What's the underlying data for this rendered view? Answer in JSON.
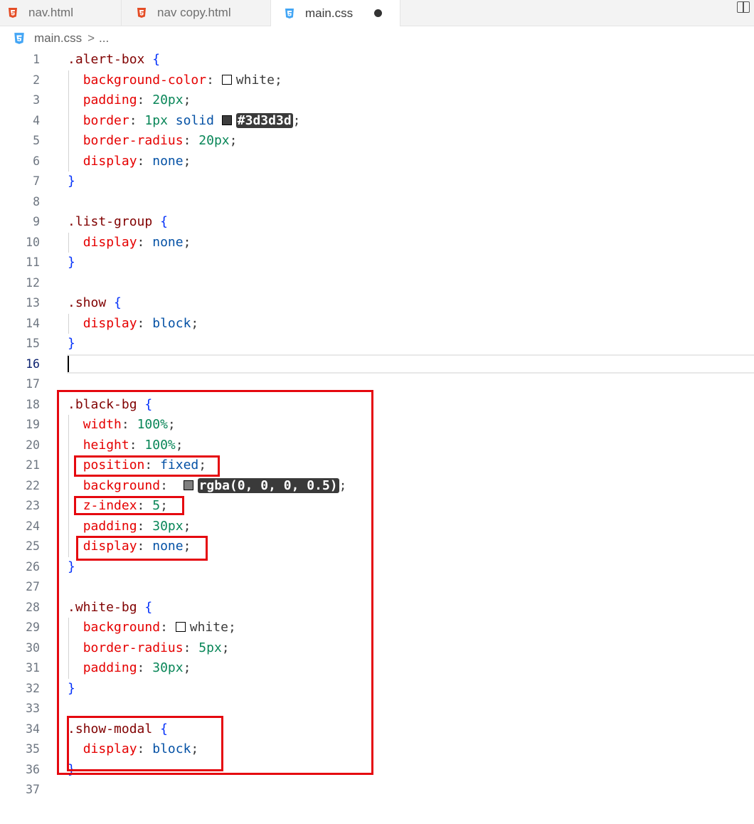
{
  "tabs": [
    {
      "label": "nav.html",
      "icon": "html5-icon"
    },
    {
      "label": "nav copy.html",
      "icon": "html5-icon"
    },
    {
      "label": "main.css",
      "icon": "css3-icon",
      "active": true,
      "modified": true
    }
  ],
  "breadcrumb": {
    "file": "main.css",
    "separator": ">",
    "rest": "..."
  },
  "colors": {
    "html_icon": "#e44d26",
    "css_icon": "#42a5f5",
    "annotation_box": "#e5080f"
  },
  "editor": {
    "current_line": 16,
    "lines": [
      {
        "n": "1",
        "tokens": [
          {
            "t": ".alert-box",
            "c": "sel"
          },
          {
            "t": " ",
            "c": "punc"
          },
          {
            "t": "{",
            "c": "brace"
          }
        ]
      },
      {
        "n": "2",
        "tokens": [
          {
            "t": "  ",
            "c": "punc"
          },
          {
            "t": "background-color",
            "c": "prop"
          },
          {
            "t": ": ",
            "c": "punc"
          },
          {
            "t": "",
            "c": "swatch-white"
          },
          {
            "t": "white",
            "c": "punc"
          },
          {
            "t": ";",
            "c": "punc"
          }
        ]
      },
      {
        "n": "3",
        "tokens": [
          {
            "t": "  ",
            "c": "punc"
          },
          {
            "t": "padding",
            "c": "prop"
          },
          {
            "t": ": ",
            "c": "punc"
          },
          {
            "t": "20px",
            "c": "num"
          },
          {
            "t": ";",
            "c": "punc"
          }
        ]
      },
      {
        "n": "4",
        "tokens": [
          {
            "t": "  ",
            "c": "punc"
          },
          {
            "t": "border",
            "c": "prop"
          },
          {
            "t": ": ",
            "c": "punc"
          },
          {
            "t": "1px",
            "c": "num"
          },
          {
            "t": " ",
            "c": "punc"
          },
          {
            "t": "solid",
            "c": "kw"
          },
          {
            "t": " ",
            "c": "punc"
          },
          {
            "t": "",
            "c": "swatch-dark"
          },
          {
            "t": "#3d3d3d",
            "c": "hl"
          },
          {
            "t": ";",
            "c": "punc"
          }
        ]
      },
      {
        "n": "5",
        "tokens": [
          {
            "t": "  ",
            "c": "punc"
          },
          {
            "t": "border-radius",
            "c": "prop"
          },
          {
            "t": ": ",
            "c": "punc"
          },
          {
            "t": "20px",
            "c": "num"
          },
          {
            "t": ";",
            "c": "punc"
          }
        ]
      },
      {
        "n": "6",
        "tokens": [
          {
            "t": "  ",
            "c": "punc"
          },
          {
            "t": "display",
            "c": "prop"
          },
          {
            "t": ": ",
            "c": "punc"
          },
          {
            "t": "none",
            "c": "kw"
          },
          {
            "t": ";",
            "c": "punc"
          }
        ]
      },
      {
        "n": "7",
        "tokens": [
          {
            "t": "}",
            "c": "brace"
          }
        ]
      },
      {
        "n": "8",
        "tokens": []
      },
      {
        "n": "9",
        "tokens": [
          {
            "t": ".list-group",
            "c": "sel"
          },
          {
            "t": " ",
            "c": "punc"
          },
          {
            "t": "{",
            "c": "brace"
          }
        ]
      },
      {
        "n": "10",
        "tokens": [
          {
            "t": "  ",
            "c": "punc"
          },
          {
            "t": "display",
            "c": "prop"
          },
          {
            "t": ": ",
            "c": "punc"
          },
          {
            "t": "none",
            "c": "kw"
          },
          {
            "t": ";",
            "c": "punc"
          }
        ]
      },
      {
        "n": "11",
        "tokens": [
          {
            "t": "}",
            "c": "brace"
          }
        ]
      },
      {
        "n": "12",
        "tokens": []
      },
      {
        "n": "13",
        "tokens": [
          {
            "t": ".show",
            "c": "sel"
          },
          {
            "t": " ",
            "c": "punc"
          },
          {
            "t": "{",
            "c": "brace"
          }
        ]
      },
      {
        "n": "14",
        "tokens": [
          {
            "t": "  ",
            "c": "punc"
          },
          {
            "t": "display",
            "c": "prop"
          },
          {
            "t": ": ",
            "c": "punc"
          },
          {
            "t": "block",
            "c": "kw"
          },
          {
            "t": ";",
            "c": "punc"
          }
        ]
      },
      {
        "n": "15",
        "tokens": [
          {
            "t": "}",
            "c": "brace"
          }
        ]
      },
      {
        "n": "16",
        "tokens": []
      },
      {
        "n": "17",
        "tokens": []
      },
      {
        "n": "18",
        "tokens": [
          {
            "t": ".black-bg",
            "c": "sel"
          },
          {
            "t": " ",
            "c": "punc"
          },
          {
            "t": "{",
            "c": "brace"
          }
        ]
      },
      {
        "n": "19",
        "tokens": [
          {
            "t": "  ",
            "c": "punc"
          },
          {
            "t": "width",
            "c": "prop"
          },
          {
            "t": ": ",
            "c": "punc"
          },
          {
            "t": "100%",
            "c": "num"
          },
          {
            "t": ";",
            "c": "punc"
          }
        ]
      },
      {
        "n": "20",
        "tokens": [
          {
            "t": "  ",
            "c": "punc"
          },
          {
            "t": "height",
            "c": "prop"
          },
          {
            "t": ": ",
            "c": "punc"
          },
          {
            "t": "100%",
            "c": "num"
          },
          {
            "t": ";",
            "c": "punc"
          }
        ]
      },
      {
        "n": "21",
        "tokens": [
          {
            "t": "  ",
            "c": "punc"
          },
          {
            "t": "position",
            "c": "prop"
          },
          {
            "t": ": ",
            "c": "punc"
          },
          {
            "t": "fixed",
            "c": "kw"
          },
          {
            "t": ";",
            "c": "punc"
          }
        ]
      },
      {
        "n": "22",
        "tokens": [
          {
            "t": "  ",
            "c": "punc"
          },
          {
            "t": "background",
            "c": "prop"
          },
          {
            "t": ":  ",
            "c": "punc"
          },
          {
            "t": "",
            "c": "swatch-gray"
          },
          {
            "t": "rgba(0, 0, 0, 0.5)",
            "c": "hl"
          },
          {
            "t": ";",
            "c": "punc"
          }
        ]
      },
      {
        "n": "23",
        "tokens": [
          {
            "t": "  ",
            "c": "punc"
          },
          {
            "t": "z-index",
            "c": "prop"
          },
          {
            "t": ": ",
            "c": "punc"
          },
          {
            "t": "5",
            "c": "num"
          },
          {
            "t": ";",
            "c": "punc"
          }
        ]
      },
      {
        "n": "24",
        "tokens": [
          {
            "t": "  ",
            "c": "punc"
          },
          {
            "t": "padding",
            "c": "prop"
          },
          {
            "t": ": ",
            "c": "punc"
          },
          {
            "t": "30px",
            "c": "num"
          },
          {
            "t": ";",
            "c": "punc"
          }
        ]
      },
      {
        "n": "25",
        "tokens": [
          {
            "t": "  ",
            "c": "punc"
          },
          {
            "t": "display",
            "c": "prop"
          },
          {
            "t": ": ",
            "c": "punc"
          },
          {
            "t": "none",
            "c": "kw"
          },
          {
            "t": ";",
            "c": "punc"
          }
        ]
      },
      {
        "n": "26",
        "tokens": [
          {
            "t": "}",
            "c": "brace"
          }
        ]
      },
      {
        "n": "27",
        "tokens": []
      },
      {
        "n": "28",
        "tokens": [
          {
            "t": ".white-bg",
            "c": "sel"
          },
          {
            "t": " ",
            "c": "punc"
          },
          {
            "t": "{",
            "c": "brace"
          }
        ]
      },
      {
        "n": "29",
        "tokens": [
          {
            "t": "  ",
            "c": "punc"
          },
          {
            "t": "background",
            "c": "prop"
          },
          {
            "t": ": ",
            "c": "punc"
          },
          {
            "t": "",
            "c": "swatch-white"
          },
          {
            "t": "white",
            "c": "punc"
          },
          {
            "t": ";",
            "c": "punc"
          }
        ]
      },
      {
        "n": "30",
        "tokens": [
          {
            "t": "  ",
            "c": "punc"
          },
          {
            "t": "border-radius",
            "c": "prop"
          },
          {
            "t": ": ",
            "c": "punc"
          },
          {
            "t": "5px",
            "c": "num"
          },
          {
            "t": ";",
            "c": "punc"
          }
        ]
      },
      {
        "n": "31",
        "tokens": [
          {
            "t": "  ",
            "c": "punc"
          },
          {
            "t": "padding",
            "c": "prop"
          },
          {
            "t": ": ",
            "c": "punc"
          },
          {
            "t": "30px",
            "c": "num"
          },
          {
            "t": ";",
            "c": "punc"
          }
        ]
      },
      {
        "n": "32",
        "tokens": [
          {
            "t": "}",
            "c": "brace"
          }
        ]
      },
      {
        "n": "33",
        "tokens": []
      },
      {
        "n": "34",
        "tokens": [
          {
            "t": ".show-modal",
            "c": "sel"
          },
          {
            "t": " ",
            "c": "punc"
          },
          {
            "t": "{",
            "c": "brace"
          }
        ]
      },
      {
        "n": "35",
        "tokens": [
          {
            "t": "  ",
            "c": "punc"
          },
          {
            "t": "display",
            "c": "prop"
          },
          {
            "t": ": ",
            "c": "punc"
          },
          {
            "t": "block",
            "c": "kw"
          },
          {
            "t": ";",
            "c": "punc"
          }
        ]
      },
      {
        "n": "36",
        "tokens": [
          {
            "t": "}",
            "c": "brace"
          }
        ]
      },
      {
        "n": "37",
        "tokens": []
      }
    ]
  }
}
